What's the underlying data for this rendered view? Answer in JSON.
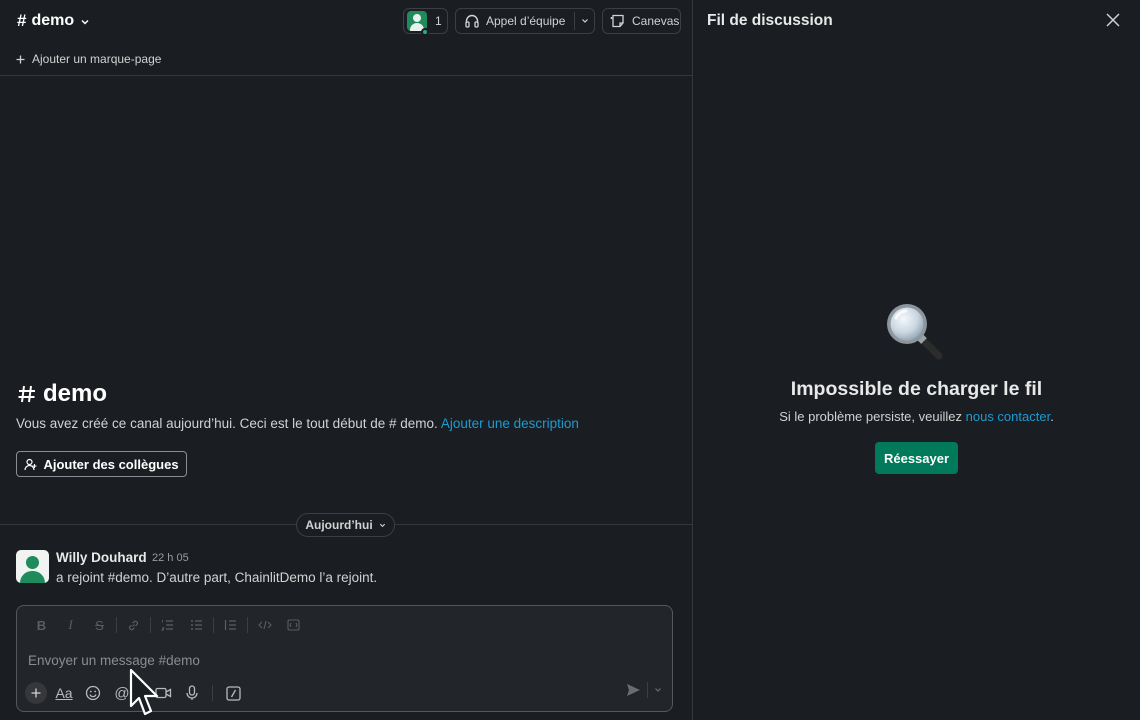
{
  "channel": {
    "name": "demo",
    "member_count": "1",
    "call_label": "Appel d’équipe",
    "canvas_label": "Canevas",
    "bookmark_label": "Ajouter un marque-page"
  },
  "intro": {
    "title": "demo",
    "text_before": "Vous avez créé ce canal aujourd’hui. Ceci est le tout début de",
    "text_channel": "demo.",
    "link": "Ajouter une description",
    "add_colleagues_label": "Ajouter des collègues"
  },
  "divider": {
    "label": "Aujourd’hui"
  },
  "messages": [
    {
      "author": "Willy Douhard",
      "time": "22 h 05",
      "text": "a rejoint #demo. D’autre part, ChainlitDemo l’a rejoint."
    }
  ],
  "composer": {
    "placeholder": "Envoyer un message #demo"
  },
  "thread": {
    "title": "Fil de discussion",
    "error_title": "Impossible de charger le fil",
    "error_text": "Si le problème persiste, veuillez",
    "error_link": "nous contacter",
    "error_suffix": ".",
    "retry_label": "Réessayer"
  },
  "icons": {
    "members": "avatar-icon",
    "call": "headphones-icon",
    "canvas": "canvas-icon",
    "close": "close-icon",
    "magnifier": "magnifying-glass-icon",
    "send": "send-icon"
  },
  "colors": {
    "background": "#1a1d21",
    "link": "#1d9bd1",
    "primary_button": "#007a5a",
    "avatar_green": "#1f8a5b"
  }
}
